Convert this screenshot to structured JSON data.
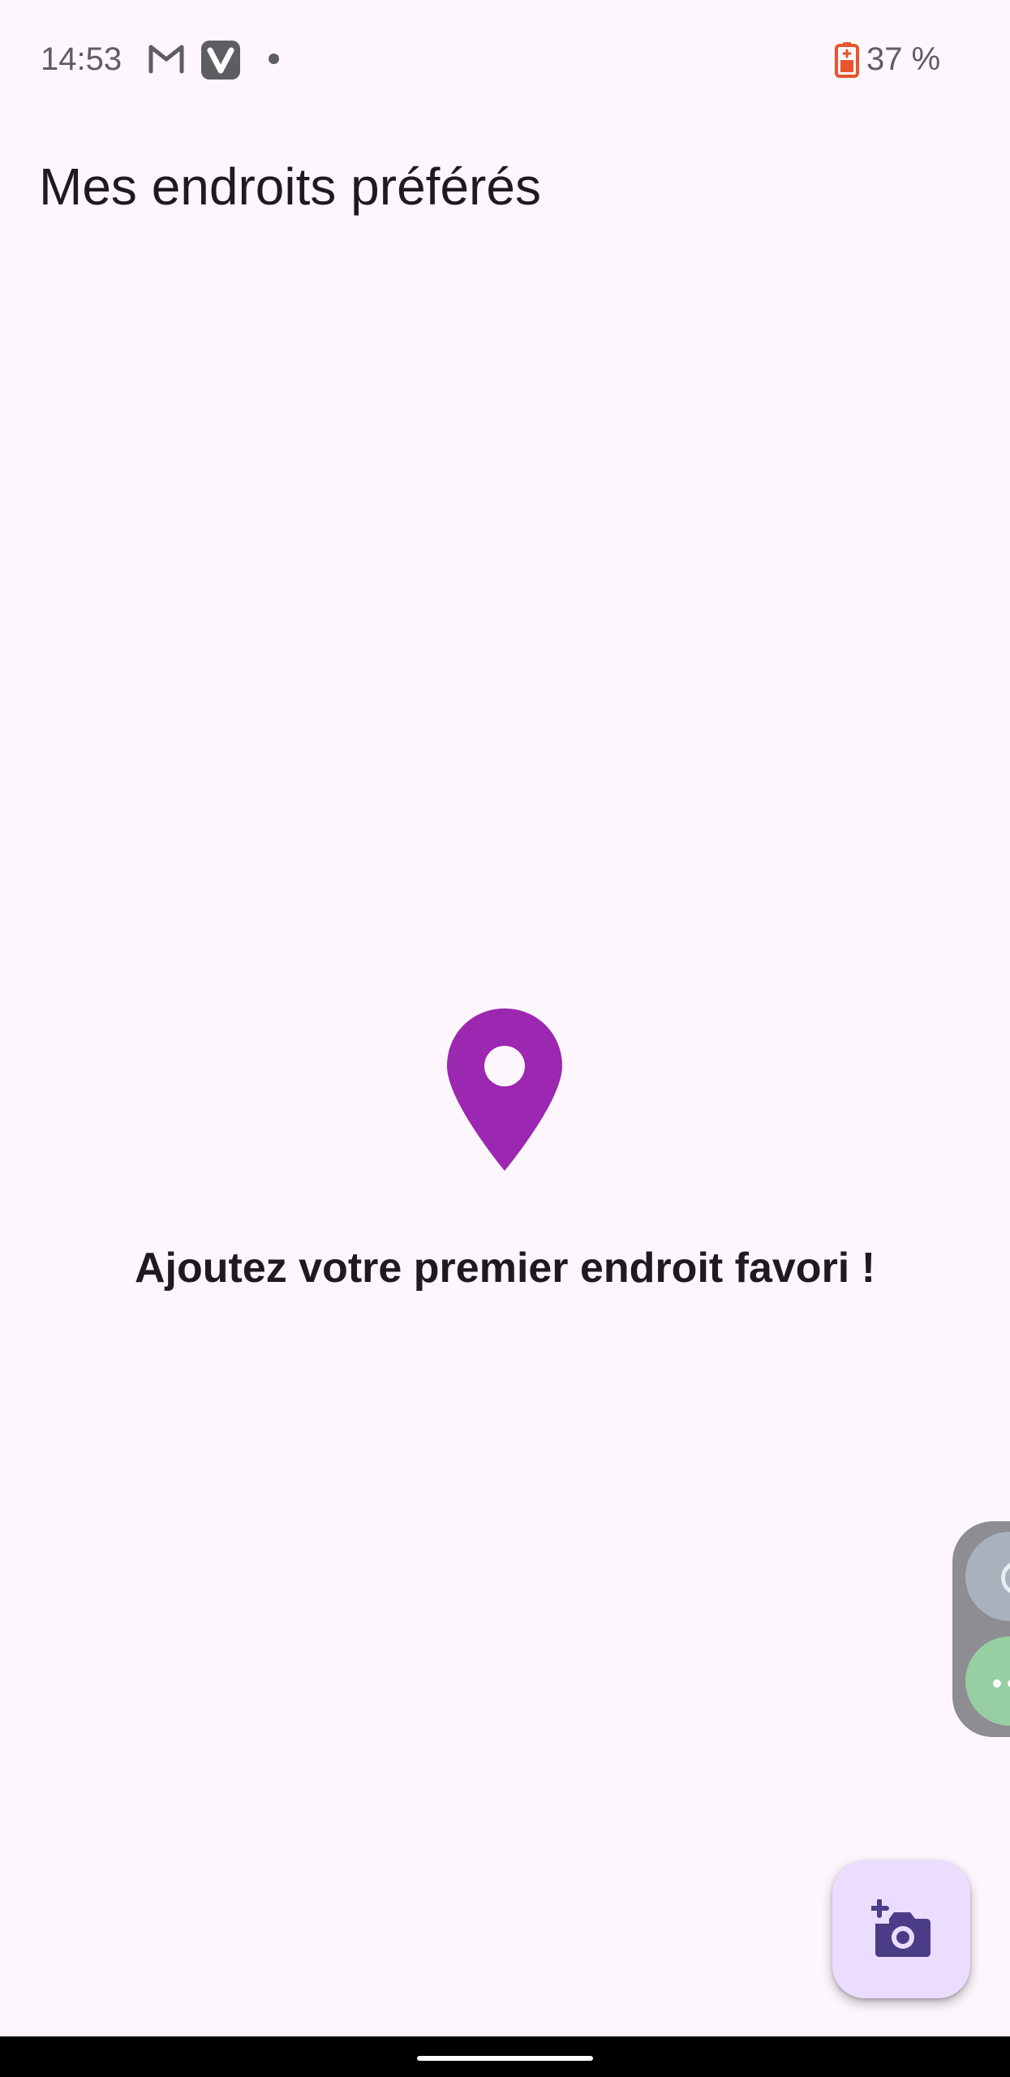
{
  "status_bar": {
    "time": "14:53",
    "notification_icons": [
      "gmail-icon",
      "vivaldi-icon",
      "notification-dot"
    ],
    "battery_icon": "battery-saver-icon",
    "battery_text": "37 %"
  },
  "app": {
    "title": "Mes endroits préférés"
  },
  "empty_state": {
    "icon": "location-pin-icon",
    "icon_color": "#9C27B0",
    "message": "Ajoutez votre premier endroit favori !"
  },
  "fab": {
    "icon": "add-a-photo-icon",
    "background": "#EADDFF",
    "icon_color": "#4A3C86"
  },
  "side_panel": {
    "bubbles": [
      "floating-bubble-top",
      "floating-bubble-bottom"
    ]
  }
}
